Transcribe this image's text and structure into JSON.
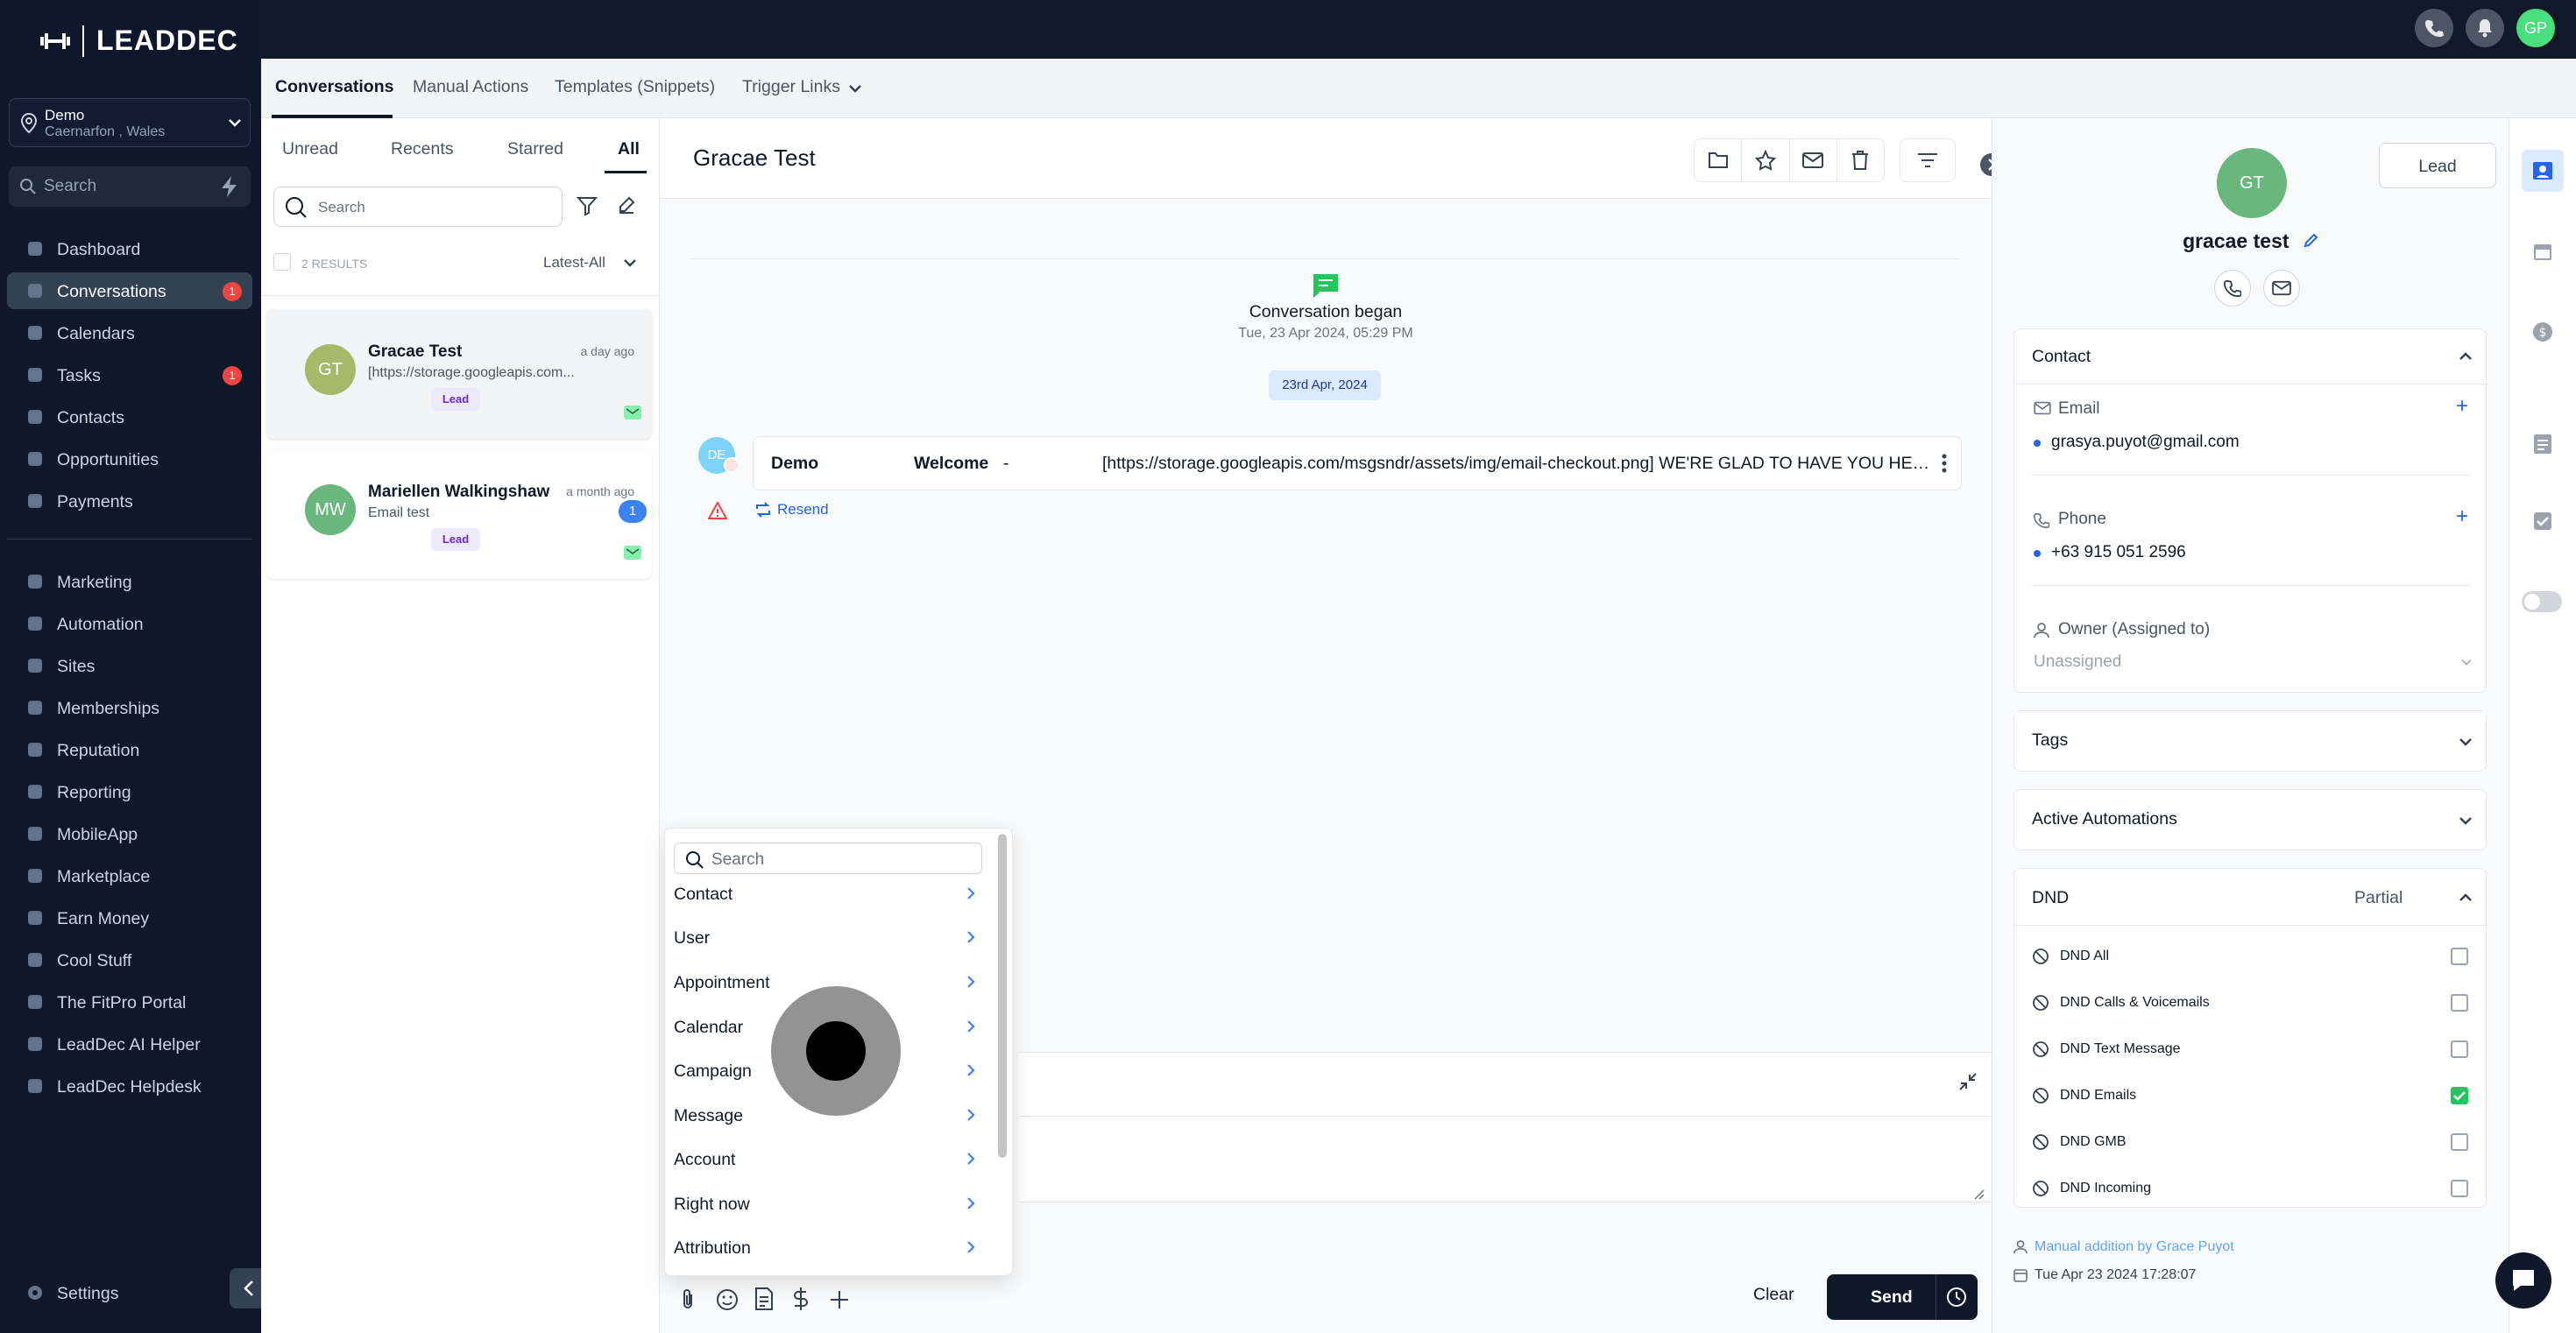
{
  "brand": {
    "name": "LEADDEC"
  },
  "location": {
    "name": "Demo",
    "sub": "Caernarfon , Wales"
  },
  "sidebar": {
    "search_placeholder": "Search",
    "items": [
      {
        "label": "Dashboard",
        "icon": "dashboard-icon"
      },
      {
        "label": "Conversations",
        "icon": "chat-icon",
        "badge": "1",
        "active": true
      },
      {
        "label": "Calendars",
        "icon": "calendar-icon"
      },
      {
        "label": "Tasks",
        "icon": "tasks-icon",
        "badge": "1"
      },
      {
        "label": "Contacts",
        "icon": "user-icon"
      },
      {
        "label": "Opportunities",
        "icon": "filter-icon"
      },
      {
        "label": "Payments",
        "icon": "card-icon"
      },
      {
        "label": "Marketing",
        "icon": "megaphone-icon"
      },
      {
        "label": "Automation",
        "icon": "automation-icon"
      },
      {
        "label": "Sites",
        "icon": "sites-icon"
      },
      {
        "label": "Memberships",
        "icon": "memberships-icon"
      },
      {
        "label": "Reputation",
        "icon": "star-icon"
      },
      {
        "label": "Reporting",
        "icon": "chart-icon"
      },
      {
        "label": "MobileApp",
        "icon": "mobile-icon"
      },
      {
        "label": "Marketplace",
        "icon": "cart-icon"
      },
      {
        "label": "Earn Money",
        "icon": "money-icon"
      },
      {
        "label": "Cool Stuff",
        "icon": "flame-icon"
      },
      {
        "label": "The FitPro Portal",
        "icon": "dumbbell-icon"
      },
      {
        "label": "LeadDec AI Helper",
        "icon": "robot-icon"
      },
      {
        "label": "LeadDec Helpdesk",
        "icon": "info-icon"
      }
    ],
    "settings": "Settings"
  },
  "topbar": {
    "avatar": "GP"
  },
  "tabs": [
    "Conversations",
    "Manual Actions",
    "Templates (Snippets)",
    "Trigger Links"
  ],
  "list": {
    "filters": [
      "Unread",
      "Recents",
      "Starred",
      "All"
    ],
    "search_placeholder": "Search",
    "results": "2 RESULTS",
    "sort": "Latest-All",
    "items": [
      {
        "initials": "GT",
        "name": "Gracae Test",
        "time": "a day ago",
        "preview": "[https://storage.googleapis.com...",
        "tag": "Lead",
        "color": "#a8b86a"
      },
      {
        "initials": "MW",
        "name": "Mariellen Walkingshaw",
        "time": "a month ago",
        "preview": "Email test",
        "tag": "Lead",
        "unread": "1",
        "color": "#6ab77e"
      }
    ]
  },
  "chat": {
    "title": "Gracae Test",
    "began": "Conversation began",
    "began_date": "Tue, 23 Apr 2024, 05:29 PM",
    "date_pill": "23rd Apr, 2024",
    "message": {
      "avatar": "DE",
      "from": "Demo",
      "subject": "Welcome",
      "dash": "-",
      "text": "[https://storage.googleapis.com/msgsndr/assets/img/email-checkout.png] WE'RE GLAD TO HAVE YOU HERE, GRACAE"
    },
    "resend": "Resend",
    "clear": "Clear",
    "send": "Send"
  },
  "popup": {
    "search_placeholder": "Search",
    "items": [
      "Contact",
      "User",
      "Appointment",
      "Calendar",
      "Campaign",
      "Message",
      "Account",
      "Right now",
      "Attribution"
    ]
  },
  "contact": {
    "lead_button": "Lead",
    "initials": "GT",
    "name": "gracae test",
    "section": "Contact",
    "email_label": "Email",
    "email": "grasya.puyot@gmail.com",
    "phone_label": "Phone",
    "phone": "+63 915 051 2596",
    "owner_label": "Owner (Assigned to)",
    "owner": "Unassigned",
    "tags": "Tags",
    "automations": "Active Automations",
    "dnd": "DND",
    "dnd_status": "Partial",
    "dnd_items": [
      {
        "label": "DND All",
        "checked": false
      },
      {
        "label": "DND Calls & Voicemails",
        "checked": false
      },
      {
        "label": "DND Text Message",
        "checked": false
      },
      {
        "label": "DND Emails",
        "checked": true
      },
      {
        "label": "DND GMB",
        "checked": false
      },
      {
        "label": "DND Incoming",
        "checked": false
      }
    ],
    "added_by": "Manual addition by Grace Puyot",
    "added_at": "Tue Apr 23 2024 17:28:07"
  }
}
